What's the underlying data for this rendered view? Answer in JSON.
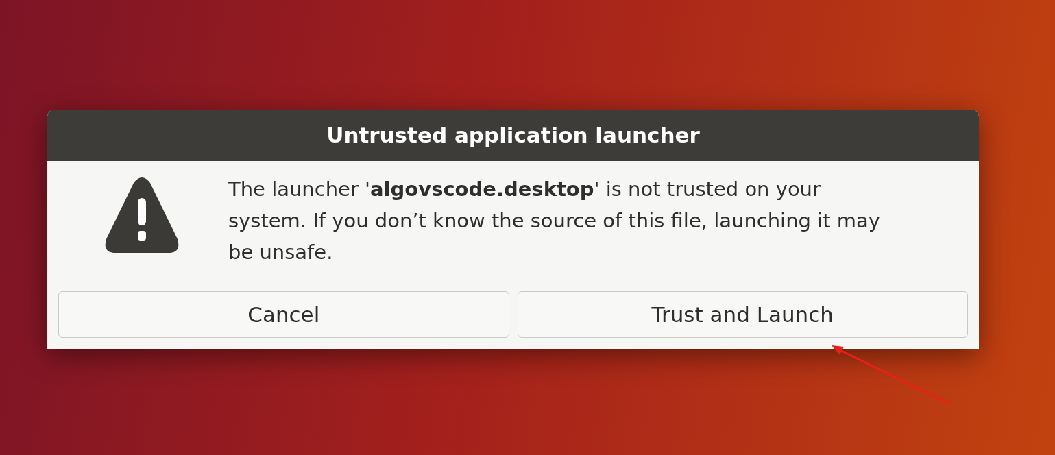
{
  "dialog": {
    "title": "Untrusted application launcher",
    "message": "The launcher '**algovscode.desktop**' is not trusted on your system. If you don’t know the source of this file, launching it may be unsafe.",
    "buttons": [
      {
        "label": "Cancel"
      },
      {
        "label": "Trust and Launch"
      }
    ]
  }
}
